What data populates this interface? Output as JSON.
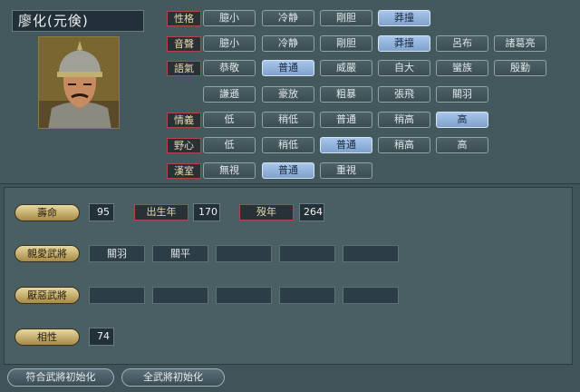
{
  "officer": {
    "name": "廖化(元倹)"
  },
  "traits": {
    "personality": {
      "label": "性格",
      "options": [
        "臆小",
        "冷静",
        "剛胆",
        "莽撞"
      ],
      "selected": 3
    },
    "voice": {
      "label": "音聲",
      "options": [
        "臆小",
        "冷静",
        "剛胆",
        "莽撞",
        "呂布",
        "諸葛亮"
      ],
      "selected": 3
    },
    "tone": {
      "label": "語氣",
      "options": [
        "恭敬",
        "普通",
        "威嚴",
        "自大",
        "蠻族",
        "殷勤",
        "謙遜",
        "豪放",
        "粗暴",
        "張飛",
        "關羽"
      ],
      "selected": 1
    },
    "loyalty": {
      "label": "情義",
      "options": [
        "低",
        "稍低",
        "普通",
        "稍高",
        "高"
      ],
      "selected": 4
    },
    "ambition": {
      "label": "野心",
      "options": [
        "低",
        "稍低",
        "普通",
        "稍高",
        "高"
      ],
      "selected": 2
    },
    "han": {
      "label": "漢室",
      "options": [
        "無視",
        "普通",
        "重視"
      ],
      "selected": 1
    }
  },
  "stats": {
    "lifespan_label": "壽命",
    "lifespan": "95",
    "birth_label": "出生年",
    "birth": "170",
    "death_label": "歿年",
    "death": "264"
  },
  "relations": {
    "friendly_label": "親愛武將",
    "friendly": [
      "關羽",
      "關平",
      "",
      "",
      ""
    ],
    "hated_label": "厭惡武將",
    "hated": [
      "",
      "",
      "",
      "",
      ""
    ]
  },
  "compat": {
    "label": "相性",
    "value": "74"
  },
  "buttons": {
    "reset_matching": "符合武將初始化",
    "reset_all": "全武將初始化"
  }
}
